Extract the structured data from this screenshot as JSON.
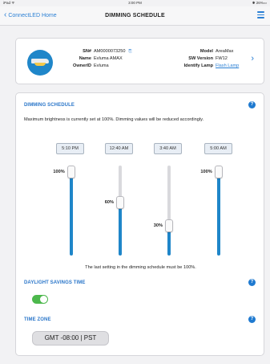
{
  "status_bar": {
    "left": "iPad ᯤ",
    "time": "3:00 PM",
    "battery": "✱ 26%▭"
  },
  "nav": {
    "back_label": "ConnectLED Home",
    "title": "DIMMING SCHEDULE",
    "menu_icon": "hamburger-icon"
  },
  "device": {
    "sn_label": "SN#",
    "sn_value": "AM0000073250",
    "name_label": "Name",
    "name_value": "Evluma AMAX",
    "owner_label": "OwnerID",
    "owner_value": "Evluma",
    "model_label": "Model",
    "model_value": "AreaMax",
    "sw_label": "SW Version",
    "sw_value": "FW12",
    "identify_label": "Identify Lamp",
    "identify_link": "Flash Lamp",
    "icon": "lamp-icon"
  },
  "schedule": {
    "title": "DIMMING SCHEDULE",
    "note": "Maximum brightness is currently set at 100%. Dimming values will be reduced accordingly.",
    "slots": [
      {
        "time": "5:10 PM",
        "level": 100,
        "label": "100%"
      },
      {
        "time": "12:40 AM",
        "level": 60,
        "label": "60%"
      },
      {
        "time": "3:40 AM",
        "level": 30,
        "label": "30%"
      },
      {
        "time": "5:00 AM",
        "level": 100,
        "label": "100%"
      }
    ],
    "final_note": "The last setting in the dimming schedule must be 100%."
  },
  "dst": {
    "title": "DAYLIGHT SAVINGS TIME",
    "enabled": true
  },
  "timezone": {
    "title": "TIME ZONE",
    "value": "GMT -08:00 | PST"
  },
  "colors": {
    "accent": "#2a7fd4",
    "toggle_on": "#4cb84c",
    "slider": "#1f86c9"
  }
}
